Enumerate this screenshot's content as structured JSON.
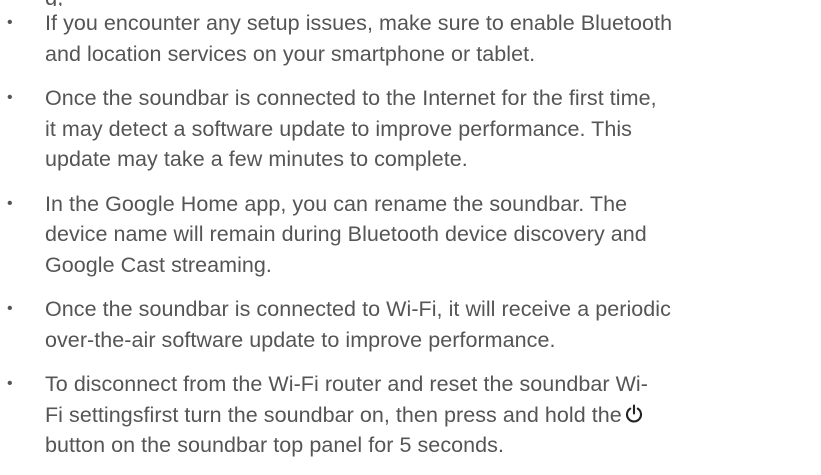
{
  "bullets": [
    {
      "lines": [
        "If you encounter any setup issues, make sure to enable Bluetooth",
        "and location services on your smartphone or tablet."
      ]
    },
    {
      "lines": [
        "Once the soundbar is connected to the Internet for the first time,",
        "it may detect a software update to improve performance. This",
        "update may take a few minutes to complete."
      ]
    },
    {
      "lines": [
        "In the Google Home app, you can rename the soundbar. The",
        "device name will remain during Bluetooth device discovery and",
        "Google Cast streaming."
      ]
    },
    {
      "lines": [
        "Once the soundbar is connected to Wi-Fi, it will receive a periodic",
        "over-the-air software update to improve performance."
      ]
    },
    {
      "lines": [
        "To disconnect from the Wi-Fi router and reset the soundbar Wi-",
        "Fi settingsfirst turn the soundbar on, then press and hold the",
        "button on the soundbar top panel for 5 seconds."
      ],
      "inline_icon": "power-icon"
    }
  ],
  "bullet_glyph": "•",
  "colors": {
    "text": "#555555",
    "background": "#ffffff"
  }
}
